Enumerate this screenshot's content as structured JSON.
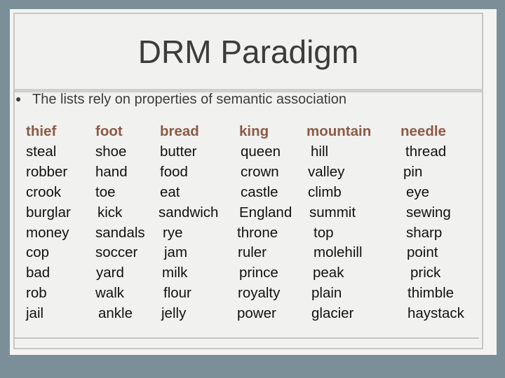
{
  "slide": {
    "title": "DRM Paradigm",
    "bullet": "The lists rely on properties of semantic association",
    "colors": {
      "header_word": "#8b5a45",
      "text": "#111111",
      "title": "#3c3c3c"
    },
    "lists": [
      {
        "header": "thief",
        "words": [
          "steal",
          "robber",
          "crook",
          "burglar",
          "money",
          "cop",
          "bad",
          "rob",
          "jail"
        ]
      },
      {
        "header": "foot",
        "words": [
          "shoe",
          "hand",
          "toe",
          "kick",
          "sandals",
          "soccer",
          "yard",
          "walk",
          "ankle"
        ]
      },
      {
        "header": "bread",
        "words": [
          "butter",
          "food",
          "eat",
          "sandwich",
          "rye",
          "jam",
          "milk",
          "flour",
          "jelly"
        ]
      },
      {
        "header": "king",
        "words": [
          "queen",
          "crown",
          "castle",
          "England",
          "throne",
          "ruler",
          "prince",
          "royalty",
          "power"
        ]
      },
      {
        "header": "mountain",
        "words": [
          "hill",
          "valley",
          "climb",
          "summit",
          "top",
          "molehill",
          "peak",
          "plain",
          "glacier"
        ]
      },
      {
        "header": "needle",
        "words": [
          "thread",
          "pin",
          "eye",
          "sewing",
          "sharp",
          "point",
          "prick",
          "thimble",
          "haystack"
        ]
      }
    ]
  }
}
